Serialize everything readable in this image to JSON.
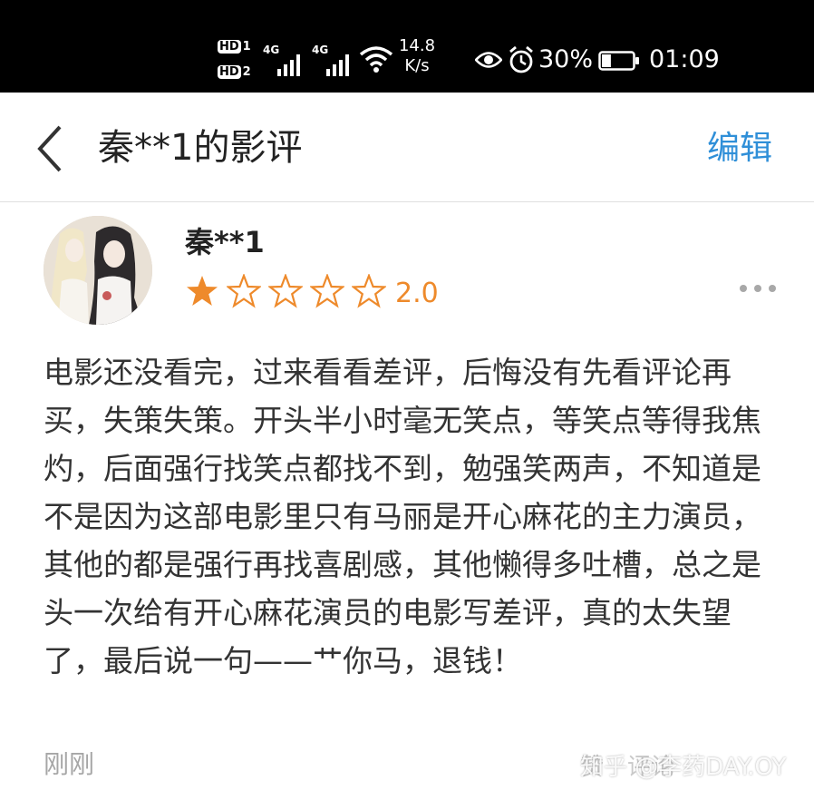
{
  "status_bar": {
    "sim1_badge": "HD",
    "sim1_index": "1",
    "sim2_badge": "HD",
    "sim2_index": "2",
    "network_type_1": "4G",
    "network_type_2": "4G",
    "network_rate_value": "14.8",
    "network_rate_unit": "K/s",
    "battery_percent": "30%",
    "battery_level": 0.3,
    "time": "01:09",
    "icons": [
      "eye-icon",
      "alarm-icon",
      "wifi-icon",
      "battery-icon",
      "signal-icon"
    ]
  },
  "header": {
    "back_icon": "chevron-left-icon",
    "title": "秦**1的影评",
    "edit_label": "编辑",
    "edit_color": "#2f8fd8"
  },
  "review": {
    "username": "秦**1",
    "rating": {
      "value": "2.0",
      "filled_stars": 1,
      "total_stars": 5,
      "star_color": "#ee8a2b"
    },
    "more_icon": "more-dots-icon",
    "text": "电影还没看完，过来看看差评，后悔没有先看评论再买，失策失策。开头半小时毫无笑点，等笑点等得我焦灼，后面强行找笑点都找不到，勉强笑两声，不知道是不是因为这部电影里只有马丽是开心麻花的主力演员，其他的都是强行再找喜剧感，其他懒得多吐槽，总之是头一次给有开心麻花演员的电影写差评，真的太失望了，最后说一句——艹你马，退钱！",
    "time": "刚刚"
  },
  "footer": {
    "ghost_labels": "赞　评论",
    "watermark": "知乎 @李药DAY.OY"
  }
}
